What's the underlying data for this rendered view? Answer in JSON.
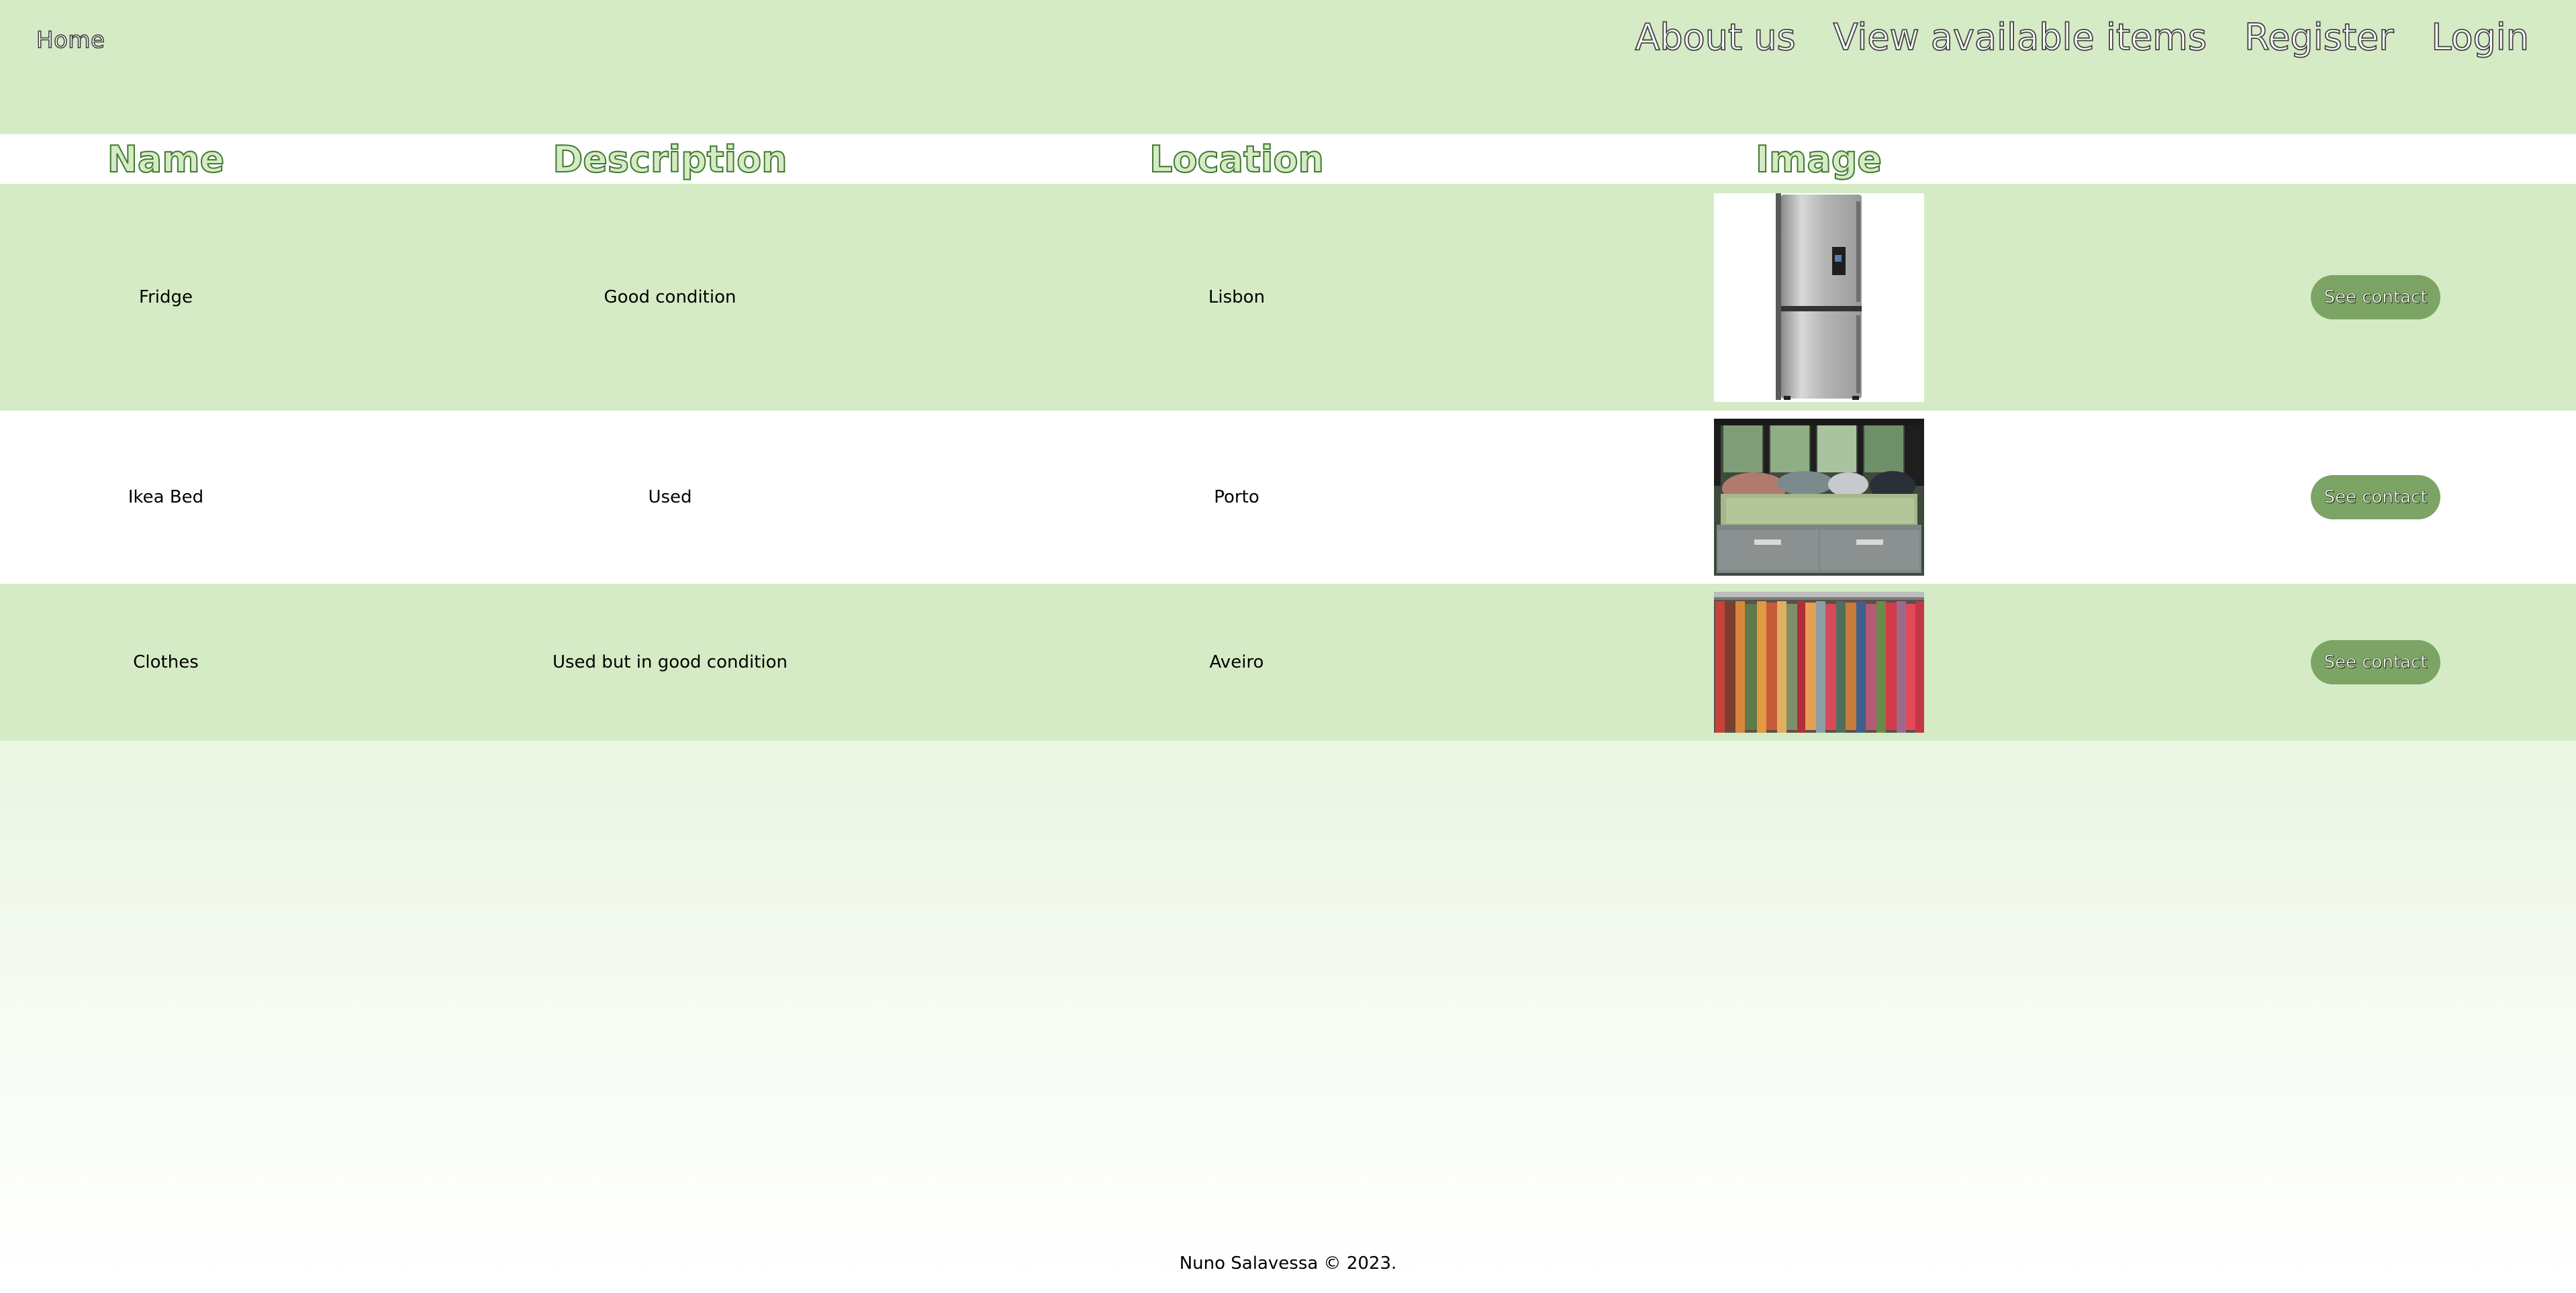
{
  "header": {
    "home_label": "Home",
    "nav": {
      "about_label": "About us",
      "items_label": "View available items",
      "register_label": "Register",
      "login_label": "Login"
    }
  },
  "table": {
    "columns": {
      "name": "Name",
      "description": "Description",
      "location": "Location",
      "image": "Image"
    },
    "rows": [
      {
        "name": "Fridge",
        "description": "Good condition",
        "location": "Lisbon",
        "image": "fridge-photo",
        "button_label": "See contact"
      },
      {
        "name": "Ikea Bed",
        "description": "Used",
        "location": "Porto",
        "image": "bed-photo",
        "button_label": "See contact"
      },
      {
        "name": "Clothes",
        "description": "Used but in good condition",
        "location": "Aveiro",
        "image": "clothes-rack-photo",
        "button_label": "See contact"
      }
    ]
  },
  "footer": {
    "copyright": "Nuno Salavessa © 2023."
  },
  "colors": {
    "light_green": "#d5ebc5",
    "button_green": "#7ca464",
    "heading_outline": "#3e7a2d"
  }
}
